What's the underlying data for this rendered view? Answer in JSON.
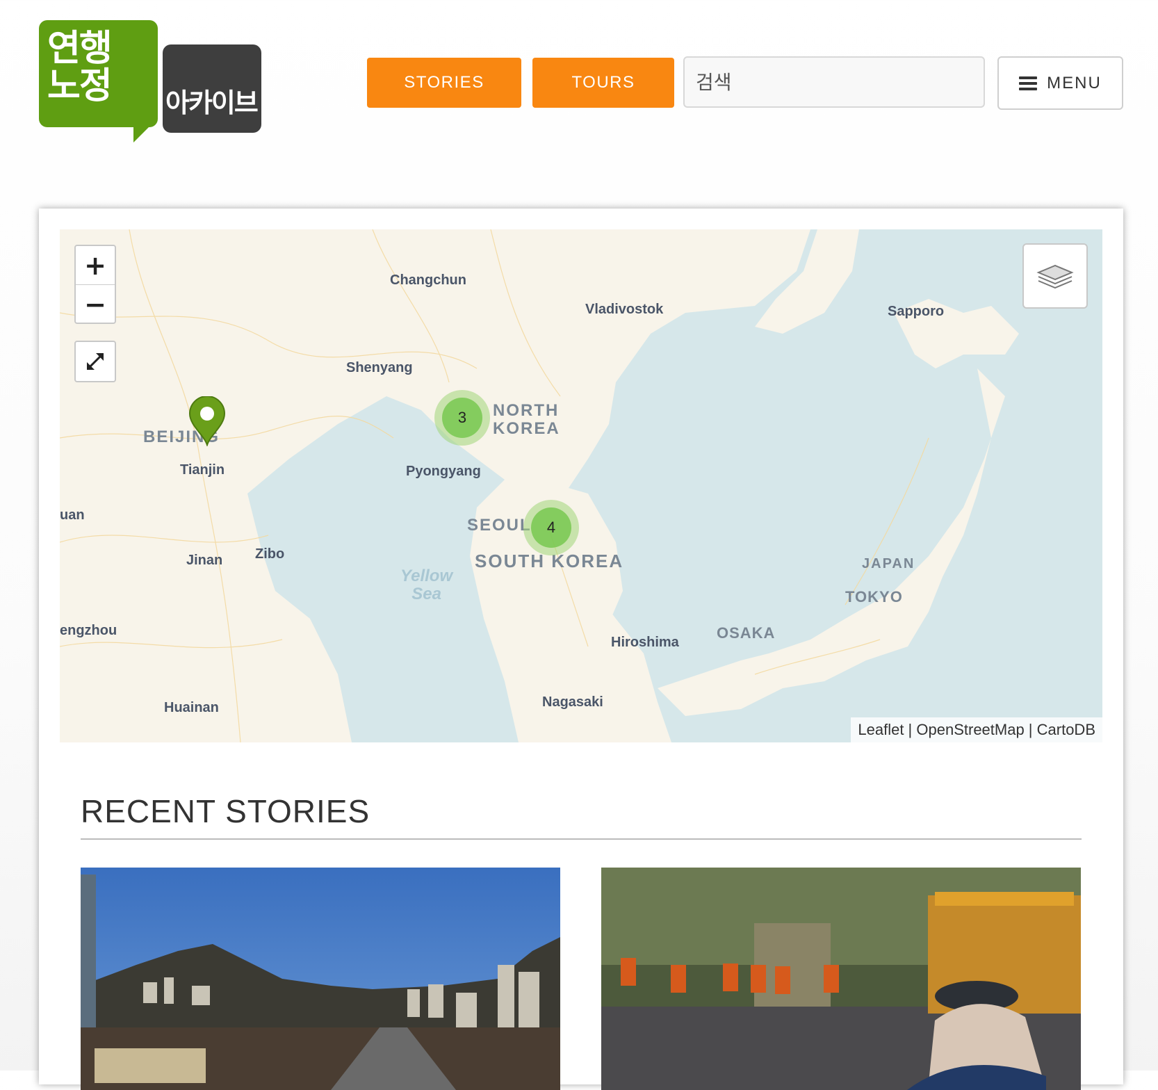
{
  "logo": {
    "green_text_line1": "연행",
    "green_text_line2": "노정",
    "dark_text": "아카이브",
    "green_color": "#5f9e12",
    "dark_color": "#3e3e3e"
  },
  "nav": {
    "stories_label": "STORIES",
    "tours_label": "TOURS",
    "accent_color": "#f98711"
  },
  "search": {
    "placeholder": "검색"
  },
  "menu": {
    "label": "MENU",
    "icon": "hamburger-icon"
  },
  "map": {
    "zoom_in": "+",
    "zoom_out": "−",
    "fullscreen_icon": "expand-icon",
    "layers_icon": "layers-icon",
    "attribution": "Leaflet | OpenStreetMap | CartoDB",
    "labels": {
      "changchun": "Changchun",
      "vladivostok": "Vladivostok",
      "sapporo": "Sapporo",
      "shenyang": "Shenyang",
      "beijing": "BEIJING",
      "tianjin": "Tianjin",
      "north_korea_1": "NORTH",
      "north_korea_2": "KOREA",
      "pyongyang": "Pyongyang",
      "yuan": "uan",
      "seoul": "SEOUL",
      "south_korea": "SOUTH KOREA",
      "jinan": "Jinan",
      "zibo": "Zibo",
      "yellow_sea_1": "Yellow",
      "yellow_sea_2": "Sea",
      "japan": "JAPAN",
      "tokyo": "TOKYO",
      "zhengzhou": "engzhou",
      "osaka": "OSAKA",
      "hiroshima": "Hiroshima",
      "huainan": "Huainan",
      "nagasaki": "Nagasaki"
    },
    "clusters": [
      {
        "name": "cluster-north",
        "count": "3"
      },
      {
        "name": "cluster-seoul",
        "count": "4"
      }
    ],
    "marker_color": "#6a9f1a"
  },
  "recent": {
    "title": "RECENT STORIES"
  }
}
